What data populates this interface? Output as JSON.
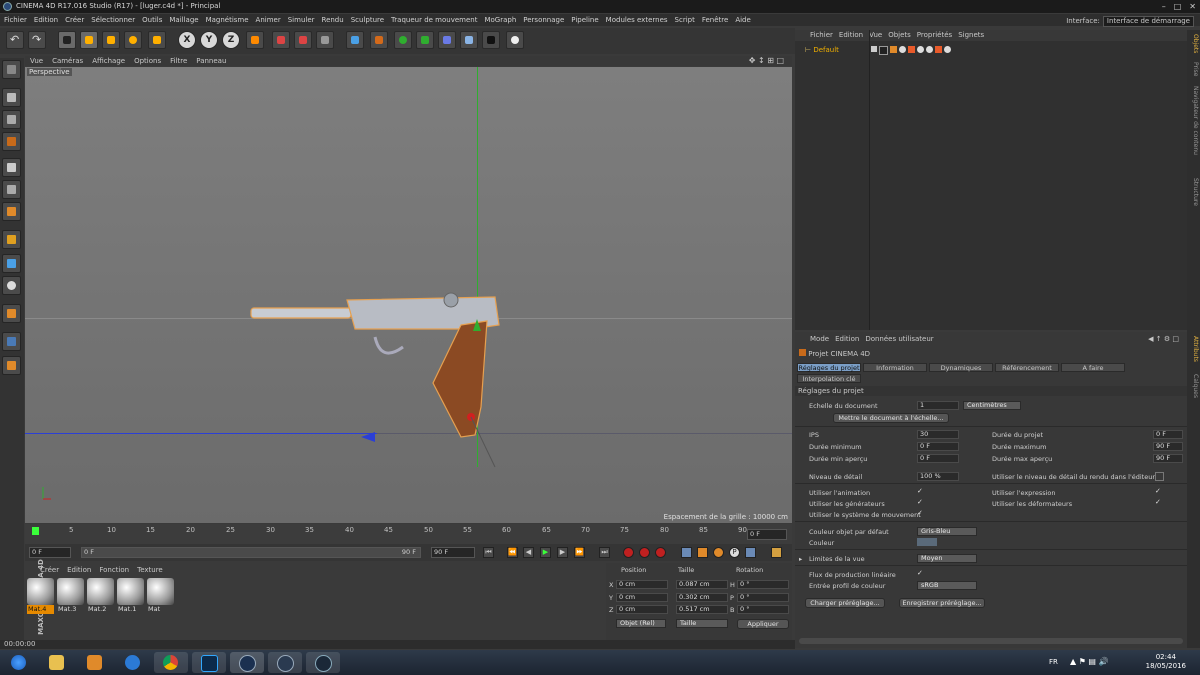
{
  "window": {
    "title": "CINEMA 4D R17.016 Studio (R17) - [luger.c4d *] - Principal"
  },
  "menubar": {
    "items": [
      "Fichier",
      "Edition",
      "Créer",
      "Sélectionner",
      "Outils",
      "Maillage",
      "Magnétisme",
      "Animer",
      "Simuler",
      "Rendu",
      "Sculpture",
      "Traqueur de mouvement",
      "MoGraph",
      "Personnage",
      "Pipeline",
      "Modules externes",
      "Script",
      "Fenêtre",
      "Aide"
    ],
    "interface_label": "Interface:",
    "interface_value": "Interface de démarrage"
  },
  "toolbar": {
    "axis_x": "X",
    "axis_y": "Y",
    "axis_z": "Z"
  },
  "viewport": {
    "menu": [
      "Vue",
      "Caméras",
      "Affichage",
      "Options",
      "Filtre",
      "Panneau"
    ],
    "camera_label": "Perspective",
    "grid_spacing": "Espacement de la grille : 10000 cm"
  },
  "timeline": {
    "ticks": [
      "0",
      "5",
      "10",
      "15",
      "20",
      "25",
      "30",
      "35",
      "40",
      "45",
      "50",
      "55",
      "60",
      "65",
      "70",
      "75",
      "80",
      "85",
      "90"
    ],
    "frame_right": "0 F",
    "start": "0 F",
    "current": "0 F",
    "end_inner": "90 F",
    "end": "90 F"
  },
  "materials": {
    "menu": [
      "Créer",
      "Edition",
      "Fonction",
      "Texture"
    ],
    "items": [
      "Mat.4",
      "Mat.3",
      "Mat.2",
      "Mat.1",
      "Mat"
    ],
    "brand": "MAXON CINEMA 4D"
  },
  "coordinates": {
    "headers": [
      "Position",
      "Taille",
      "Rotation"
    ],
    "rows": [
      {
        "axis": "X",
        "pos": "0 cm",
        "size": "0.087 cm",
        "rot_axis": "H",
        "rot": "0 °"
      },
      {
        "axis": "Y",
        "pos": "0 cm",
        "size": "0.302 cm",
        "rot_axis": "P",
        "rot": "0 °"
      },
      {
        "axis": "Z",
        "pos": "0 cm",
        "size": "0.517 cm",
        "rot_axis": "B",
        "rot": "0 °"
      }
    ],
    "mode": "Objet (Rel)",
    "size_mode": "Taille",
    "apply": "Appliquer"
  },
  "objects": {
    "menu": [
      "Fichier",
      "Edition",
      "Vue",
      "Objets",
      "Propriétés",
      "Signets"
    ],
    "item": "Default"
  },
  "attributes": {
    "menu": [
      "Mode",
      "Edition",
      "Données utilisateur"
    ],
    "title": "Projet CINEMA 4D",
    "tabs": [
      "Réglages du projet",
      "Information",
      "Dynamiques",
      "Référencement",
      "A faire",
      "Interpolation clé"
    ],
    "section": "Réglages du projet",
    "scale_label": "Echelle du document",
    "scale_value": "1",
    "scale_unit": "Centimètres",
    "scale_button": "Mettre le document à l'échelle...",
    "fps_label": "IPS",
    "fps": "30",
    "min_label": "Durée minimum",
    "min": "0 F",
    "minprev_label": "Durée min aperçu",
    "minprev": "0 F",
    "lod_label": "Niveau de détail",
    "lod": "100 %",
    "dur_label": "Durée du projet",
    "dur": "0 F",
    "max_label": "Durée maximum",
    "max": "90 F",
    "maxprev_label": "Durée max aperçu",
    "maxprev": "90 F",
    "lod_render_label": "Utiliser le niveau de détail du rendu dans l'éditeur",
    "use_anim": "Utiliser l'animation",
    "use_gen": "Utiliser les générateurs",
    "use_motion": "Utiliser le système de mouvement",
    "use_expr": "Utiliser l'expression",
    "use_deform": "Utiliser les déformateurs",
    "color_label": "Couleur objet par défaut",
    "color_value": "Gris-Bleu",
    "couleur_label": "Couleur",
    "view_limits_label": "Limites de la vue",
    "view_limits_value": "Moyen",
    "linear_label": "Flux de production linéaire",
    "profile_label": "Entrée profil de couleur",
    "profile_value": "sRGB",
    "load_preset": "Charger préréglage...",
    "save_preset": "Enregistrer préréglage..."
  },
  "side_tabs": [
    "Objets",
    "Prise",
    "Navigateur de contenu",
    "Structure",
    "Attributs",
    "Calques"
  ],
  "status": {
    "time": "00:00:00"
  },
  "taskbar": {
    "lang": "FR",
    "time": "02:44",
    "date": "18/05/2016"
  },
  "colors": {
    "accent_orange": "#e68a00",
    "tab_blue": "#7a9ec6",
    "axis_green": "#2fae2f",
    "axis_blue": "#2b3fd6",
    "axis_red": "#d02020"
  }
}
